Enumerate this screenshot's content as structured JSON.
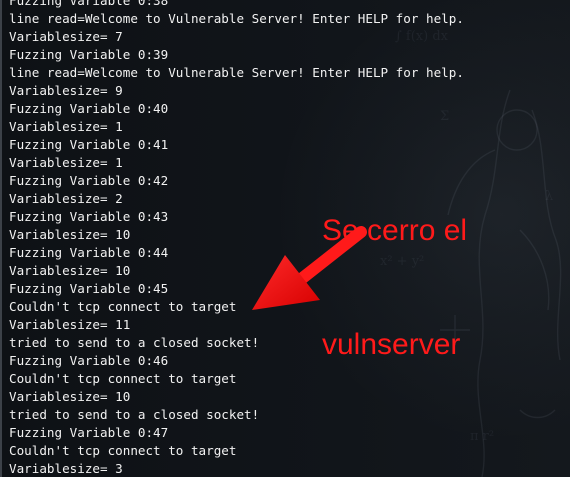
{
  "terminal": {
    "lines": [
      "Fuzzing Variable 0:38",
      "line read=Welcome to Vulnerable Server! Enter HELP for help.",
      "Variablesize= 7",
      "Fuzzing Variable 0:39",
      "line read=Welcome to Vulnerable Server! Enter HELP for help.",
      "Variablesize= 9",
      "Fuzzing Variable 0:40",
      "Variablesize= 1",
      "Fuzzing Variable 0:41",
      "Variablesize= 1",
      "Fuzzing Variable 0:42",
      "Variablesize= 2",
      "Fuzzing Variable 0:43",
      "Variablesize= 10",
      "Fuzzing Variable 0:44",
      "Variablesize= 10",
      "Fuzzing Variable 0:45",
      "Couldn't tcp connect to target",
      "Variablesize= 11",
      "tried to send to a closed socket!",
      "Fuzzing Variable 0:46",
      "Couldn't tcp connect to target",
      "Variablesize= 10",
      "tried to send to a closed socket!",
      "Fuzzing Variable 0:47",
      "Couldn't tcp connect to target",
      "Variablesize= 3"
    ]
  },
  "annotation": {
    "line1": "Se cerro el",
    "line2": "vulnserver",
    "color": "#ff1a1a"
  },
  "colors": {
    "background": "#0f1216",
    "text": "#f2f2f2"
  }
}
